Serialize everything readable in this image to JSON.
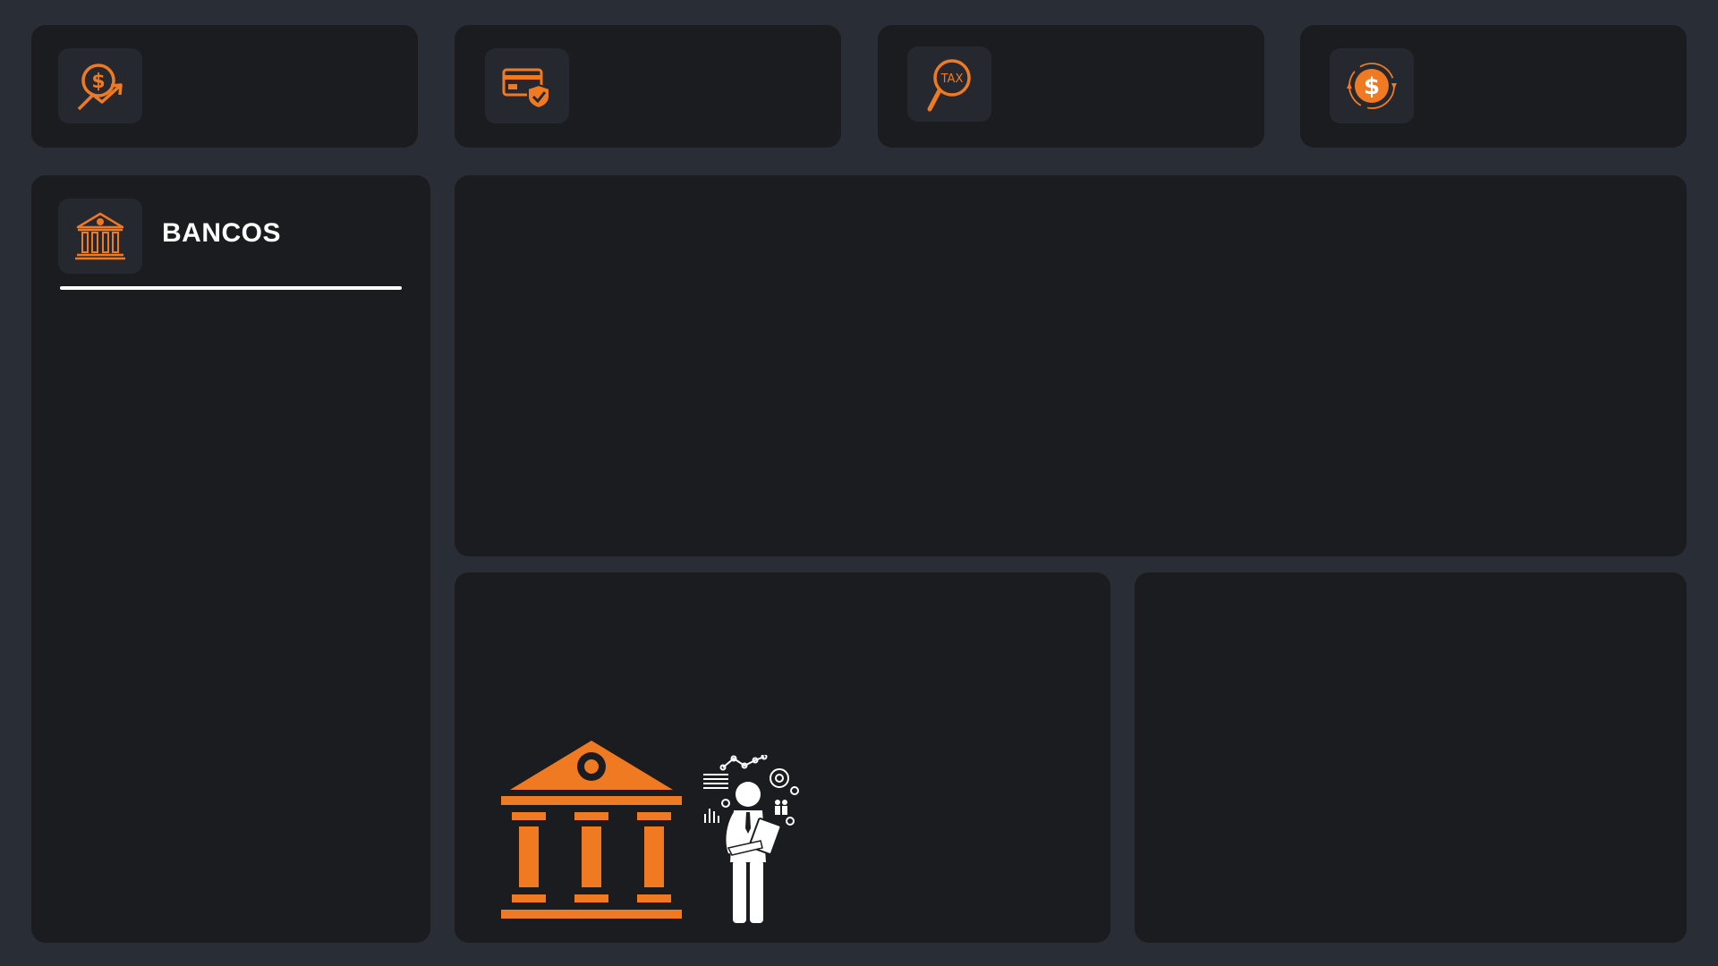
{
  "colors": {
    "background": "#282d36",
    "card": "#1b1c20",
    "icon_tile": "#262830",
    "accent": "#f07a22",
    "text": "#ffffff"
  },
  "kpi_cards": [
    {
      "icon": "money-growth-icon"
    },
    {
      "icon": "secure-card-icon"
    },
    {
      "icon": "tax-search-icon"
    },
    {
      "icon": "dollar-cycle-icon"
    }
  ],
  "sidebar": {
    "icon": "bank-icon",
    "title": "BANCOS"
  },
  "illustration": {
    "left": "bank-building-icon",
    "right": "analyst-person-icon"
  }
}
